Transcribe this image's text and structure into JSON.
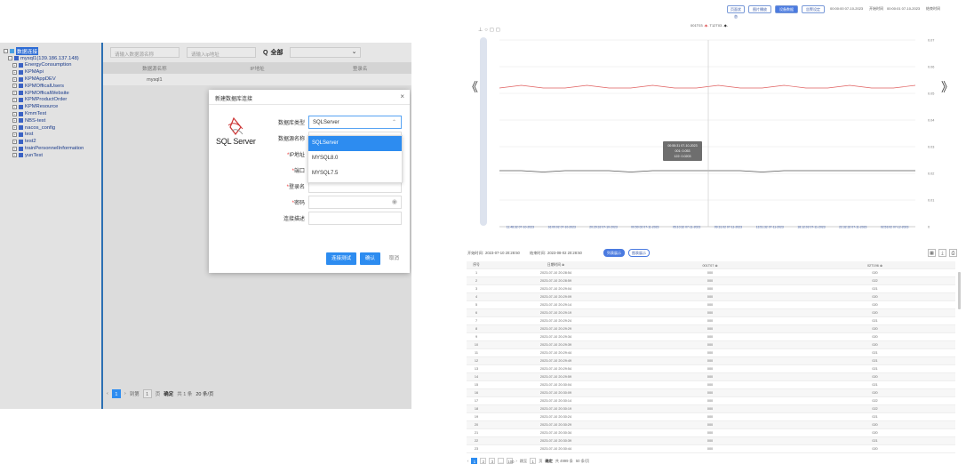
{
  "tree": {
    "items": [
      {
        "label": "数据连接",
        "level": 0,
        "selected": true
      },
      {
        "label": "mysql1(139.186.137.148)",
        "level": 1
      },
      {
        "label": "EnergyConsumption",
        "level": 2
      },
      {
        "label": "KPMApi",
        "level": 2
      },
      {
        "label": "KPMAppDEV",
        "level": 2
      },
      {
        "label": "KPMOfficalUsers",
        "level": 2
      },
      {
        "label": "KPMOfficalWebsite",
        "level": 2
      },
      {
        "label": "KPMProductOrder",
        "level": 2
      },
      {
        "label": "KPMResource",
        "level": 2
      },
      {
        "label": "KmmTest",
        "level": 2
      },
      {
        "label": "NBS-test",
        "level": 2
      },
      {
        "label": "nacos_config",
        "level": 2
      },
      {
        "label": "test",
        "level": 2
      },
      {
        "label": "test2",
        "level": 2
      },
      {
        "label": "trainPersonnelInformation",
        "level": 2
      },
      {
        "label": "yunTest",
        "level": 2
      }
    ]
  },
  "filter": {
    "name_placeholder": "请输入数据源名称",
    "ip_placeholder": "请输入ip地址",
    "query_label": "全部"
  },
  "list_table": {
    "headers": [
      "数据源名称",
      "IP地址",
      "登录名"
    ],
    "rows": [
      [
        "mysql1",
        "",
        ""
      ]
    ]
  },
  "left_pager": {
    "current": "1",
    "goto_label": "到第",
    "page_input": "1",
    "page_suffix": "页",
    "confirm": "确定",
    "total": "共 1 条",
    "per_page": "20 条/页"
  },
  "modal": {
    "title": "新建数据库连接",
    "close_glyph": "×",
    "logo_text": "SQL Server",
    "fields": [
      {
        "label": "数据库类型",
        "value": "SQLServer",
        "required": false
      },
      {
        "label": "数据源名称",
        "value": "",
        "required": false
      },
      {
        "label": "IP地址",
        "value": "",
        "required": true
      },
      {
        "label": "端口",
        "value": "",
        "required": true
      },
      {
        "label": "登录名",
        "value": "",
        "required": true
      },
      {
        "label": "密码",
        "value": "",
        "required": true
      },
      {
        "label": "连接描述",
        "value": "",
        "required": false
      }
    ],
    "options": [
      "SQLServer",
      "MYSQL8.0",
      "MYSQL7.5"
    ],
    "selected_option": "SQLServer",
    "buttons": {
      "test": "连接测试",
      "ok": "确认",
      "cancel": "取消"
    }
  },
  "right_top": {
    "buttons": [
      {
        "label": "页面状态",
        "active": false
      },
      {
        "label": "图片播放",
        "active": false
      },
      {
        "label": "设备数据",
        "active": true
      },
      {
        "label": "告警设定",
        "active": false
      }
    ],
    "range1": "00:00:00 07-10-2023",
    "range1_label": "开始时间",
    "range2": "00:00:01 07-10-2023",
    "range2_label": "结束时间"
  },
  "chart_legend": [
    "001T03",
    "T12T03"
  ],
  "chart_data": {
    "type": "line",
    "title": "",
    "ylim": [
      0,
      0.07
    ],
    "yticks": [
      "0",
      "0.01",
      "0.02",
      "0.03",
      "0.04",
      "0.05",
      "0.06",
      "0.07"
    ],
    "xticks": [
      "11:48:32 07-10-2023",
      "16:09:02 07-10-2023",
      "20:29:32 07-10-2023",
      "00:50:02 07-11-2023",
      "05:10:32 07-11-2023",
      "09:31:02 07-11-2023",
      "13:51:32 07-11-2023",
      "18:12:02 07-11-2023",
      "22:32:32 07-11-2023",
      "02:53:02 07-12-2023"
    ],
    "series": [
      {
        "name": "001T03",
        "color": "#e06060",
        "values": [
          0.052,
          0.053,
          0.052,
          0.052,
          0.053,
          0.052,
          0.052,
          0.053,
          0.052,
          0.052,
          0.053,
          0.052,
          0.052,
          0.053,
          0.052,
          0.052,
          0.053,
          0.052,
          0.052,
          0.053
        ]
      },
      {
        "name": "T12T03",
        "color": "#555555",
        "values": [
          0.021,
          0.021,
          0.0205,
          0.021,
          0.021,
          0.021,
          0.0205,
          0.021,
          0.021,
          0.021,
          0.021,
          0.021,
          0.0205,
          0.021,
          0.021,
          0.021,
          0.021,
          0.021,
          0.021,
          0.021
        ]
      }
    ],
    "tooltip": {
      "time": "00:55:31 07-10-2023",
      "line1": "001: 0.053",
      "line2": "122: 0.0203"
    }
  },
  "table_bar": {
    "start_label": "开始时间:",
    "start": "2023-07-10 20:28:50",
    "end_label": "结束时间:",
    "end": "2023-08-02 20:28:50",
    "btn1": "列表展示",
    "btn2": "图表展示"
  },
  "data_table": {
    "headers": [
      "序号",
      "日期时间 ≑",
      "001T07 ≑",
      "02T196 ≑"
    ],
    "rows": [
      [
        "1",
        "2023-07-10 20:28:54",
        "000",
        "020"
      ],
      [
        "2",
        "2023-07-10 20:28:59",
        "000",
        "022"
      ],
      [
        "3",
        "2023-07-10 20:29:04",
        "000",
        "021"
      ],
      [
        "4",
        "2023-07-10 20:29:09",
        "000",
        "020"
      ],
      [
        "5",
        "2023-07-10 20:29:14",
        "000",
        "020"
      ],
      [
        "6",
        "2023-07-10 20:29:19",
        "000",
        "020"
      ],
      [
        "7",
        "2023-07-10 20:29:24",
        "000",
        "021"
      ],
      [
        "8",
        "2023-07-10 20:29:29",
        "000",
        "020"
      ],
      [
        "9",
        "2023-07-10 20:29:34",
        "000",
        "020"
      ],
      [
        "10",
        "2023-07-10 20:29:39",
        "000",
        "020"
      ],
      [
        "11",
        "2023-07-10 20:29:44",
        "000",
        "021"
      ],
      [
        "12",
        "2023-07-10 20:29:49",
        "000",
        "021"
      ],
      [
        "13",
        "2023-07-10 20:29:54",
        "000",
        "021"
      ],
      [
        "14",
        "2023-07-10 20:29:59",
        "000",
        "020"
      ],
      [
        "15",
        "2023-07-10 20:30:04",
        "000",
        "021"
      ],
      [
        "16",
        "2023-07-10 20:30:09",
        "000",
        "020"
      ],
      [
        "17",
        "2023-07-10 20:30:14",
        "000",
        "022"
      ],
      [
        "18",
        "2023-07-10 20:30:19",
        "000",
        "022"
      ],
      [
        "19",
        "2023-07-10 20:30:24",
        "000",
        "021"
      ],
      [
        "20",
        "2023-07-10 20:30:29",
        "000",
        "020"
      ],
      [
        "21",
        "2023-07-10 20:30:34",
        "000",
        "020"
      ],
      [
        "22",
        "2023-07-10 20:30:39",
        "000",
        "021"
      ],
      [
        "23",
        "2023-07-10 20:30:44",
        "000",
        "020"
      ]
    ]
  },
  "right_pager": {
    "pages": [
      "1",
      "2",
      "3",
      "...",
      "100"
    ],
    "goto": "跳至",
    "page_input": "1",
    "page_suffix": "页",
    "confirm": "确定",
    "total": "共 4999 条",
    "per_page": "50 条/页"
  }
}
